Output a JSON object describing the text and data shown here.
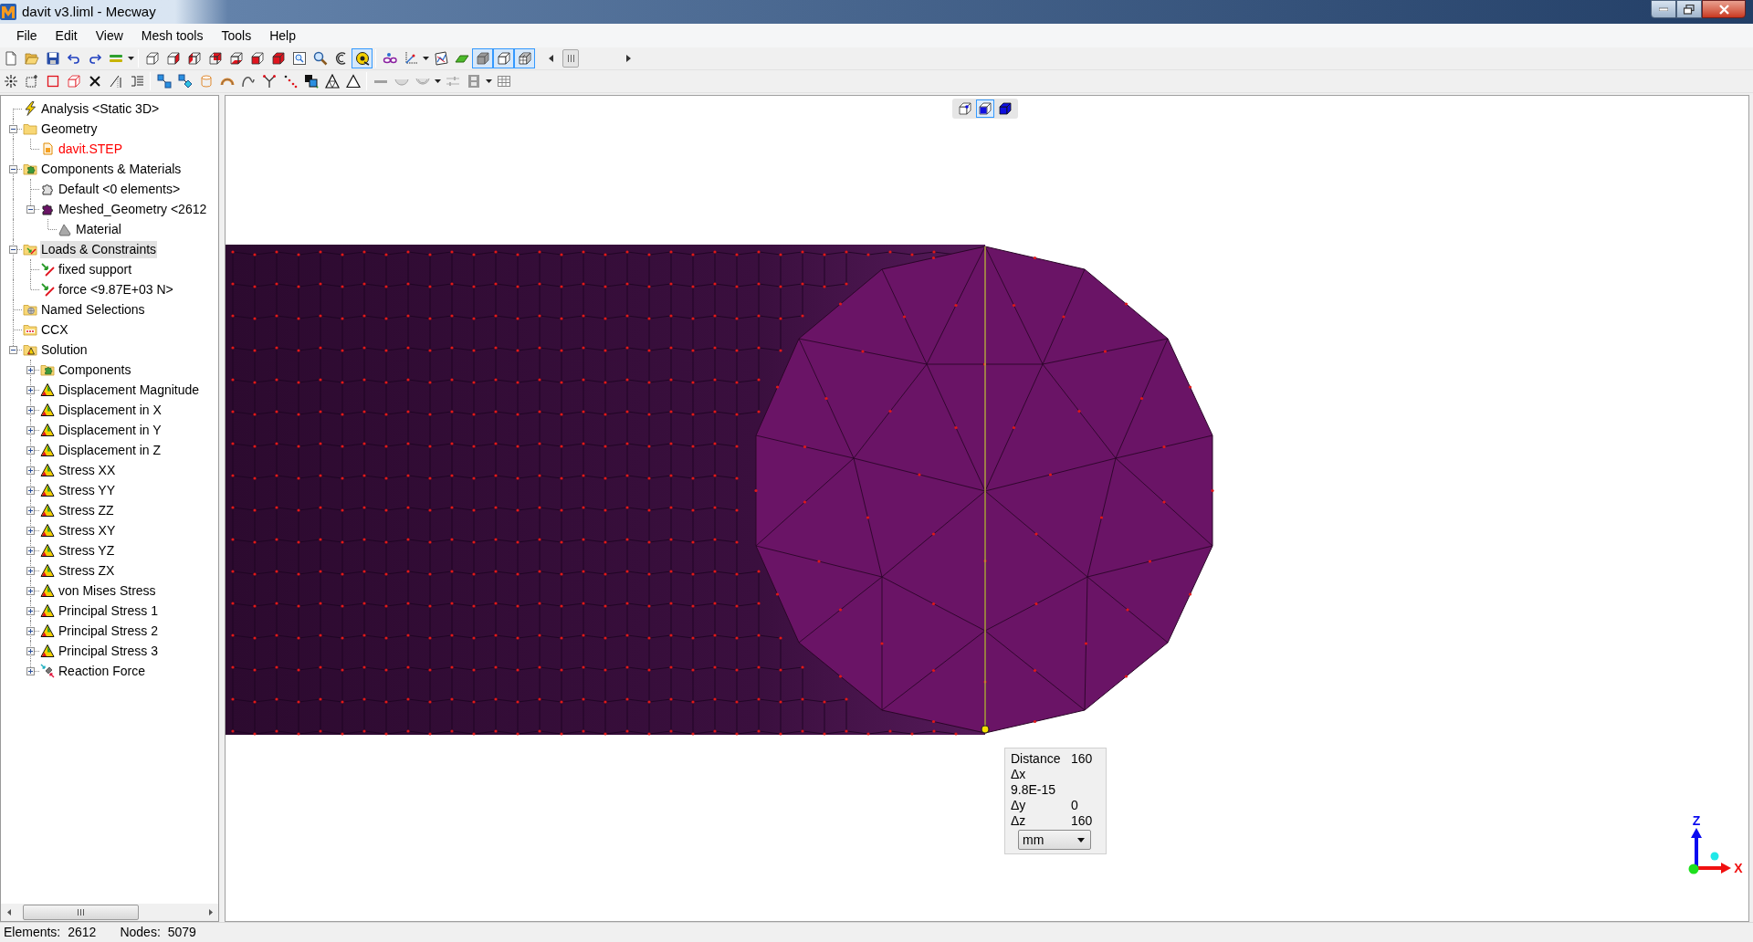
{
  "window": {
    "title": "davit v3.liml - Mecway"
  },
  "menu": [
    "File",
    "Edit",
    "View",
    "Mesh tools",
    "Tools",
    "Help"
  ],
  "toolbars": [
    [
      {
        "kind": "new-file"
      },
      {
        "kind": "open"
      },
      {
        "kind": "save"
      },
      {
        "kind": "undo"
      },
      {
        "kind": "redo"
      },
      {
        "kind": "layers"
      },
      {
        "kind": "dropdown"
      },
      {
        "kind": "separator"
      },
      {
        "kind": "view-iso"
      },
      {
        "kind": "view-right"
      },
      {
        "kind": "view-left"
      },
      {
        "kind": "view-back"
      },
      {
        "kind": "view-bottom"
      },
      {
        "kind": "view-front"
      },
      {
        "kind": "view-solid"
      },
      {
        "kind": "zoom-box"
      },
      {
        "kind": "zoom"
      },
      {
        "kind": "rotate"
      },
      {
        "kind": "measure",
        "pressed": true
      },
      {
        "kind": "separator"
      },
      {
        "kind": "glasses"
      },
      {
        "kind": "axes"
      },
      {
        "kind": "dropdown"
      },
      {
        "kind": "graph"
      },
      {
        "kind": "plane"
      },
      {
        "kind": "shaded",
        "pressed": true
      },
      {
        "kind": "wireframe",
        "pressed": true
      },
      {
        "kind": "mesh",
        "pressed": true
      },
      {
        "kind": "scroller"
      }
    ],
    [
      {
        "kind": "starburst"
      },
      {
        "kind": "box-starburst"
      },
      {
        "kind": "select-square"
      },
      {
        "kind": "select-cube"
      },
      {
        "kind": "delete"
      },
      {
        "kind": "split"
      },
      {
        "kind": "list"
      },
      {
        "kind": "separator"
      },
      {
        "kind": "link-squares"
      },
      {
        "kind": "link-shapes"
      },
      {
        "kind": "cylinder"
      },
      {
        "kind": "arc"
      },
      {
        "kind": "curve"
      },
      {
        "kind": "fork"
      },
      {
        "kind": "dots"
      },
      {
        "kind": "boxes"
      },
      {
        "kind": "tri-mesh"
      },
      {
        "kind": "triangle"
      },
      {
        "kind": "separator"
      },
      {
        "kind": "bar"
      },
      {
        "kind": "bowl"
      },
      {
        "kind": "bowl-2"
      },
      {
        "kind": "dropdown"
      },
      {
        "kind": "sliders"
      },
      {
        "kind": "film"
      },
      {
        "kind": "dropdown"
      },
      {
        "kind": "table"
      }
    ]
  ],
  "tree": [
    {
      "label": "Analysis <Static 3D>",
      "kind": "analysis",
      "selected": false
    },
    {
      "label": "Geometry",
      "kind": "folder",
      "selected": false,
      "expanded": true,
      "children": [
        {
          "label": "davit.STEP",
          "kind": "step-file",
          "selected": false,
          "color": "#ff0000"
        }
      ]
    },
    {
      "label": "Components & Materials",
      "kind": "component-folder",
      "selected": false,
      "expanded": true,
      "children": [
        {
          "label": "Default <0 elements>",
          "kind": "empty-component",
          "selected": false
        },
        {
          "label": "Meshed_Geometry <2612",
          "kind": "mesh-component",
          "selected": false,
          "expanded": true,
          "children": [
            {
              "label": "Material",
              "kind": "material",
              "selected": false
            }
          ]
        }
      ]
    },
    {
      "label": "Loads & Constraints",
      "kind": "load-folder",
      "selected": true,
      "expanded": true,
      "children": [
        {
          "label": "fixed support",
          "kind": "load",
          "selected": false
        },
        {
          "label": "force <9.87E+03 N>",
          "kind": "load",
          "selected": false
        }
      ]
    },
    {
      "label": "Named Selections",
      "kind": "selection-folder",
      "selected": false
    },
    {
      "label": "CCX",
      "kind": "solver-folder",
      "selected": false
    },
    {
      "label": "Solution",
      "kind": "solution-folder",
      "selected": false,
      "expanded": true,
      "children": [
        {
          "label": "Components",
          "kind": "component-folder",
          "selected": false,
          "expanded": false
        },
        {
          "label": "Displacement Magnitude",
          "kind": "result",
          "selected": false,
          "expanded": false
        },
        {
          "label": "Displacement in X",
          "kind": "result",
          "selected": false,
          "expanded": false
        },
        {
          "label": "Displacement in Y",
          "kind": "result",
          "selected": false,
          "expanded": false
        },
        {
          "label": "Displacement in Z",
          "kind": "result",
          "selected": false,
          "expanded": false
        },
        {
          "label": "Stress XX",
          "kind": "result",
          "selected": false,
          "expanded": false
        },
        {
          "label": "Stress YY",
          "kind": "result",
          "selected": false,
          "expanded": false
        },
        {
          "label": "Stress ZZ",
          "kind": "result",
          "selected": false,
          "expanded": false
        },
        {
          "label": "Stress XY",
          "kind": "result",
          "selected": false,
          "expanded": false
        },
        {
          "label": "Stress YZ",
          "kind": "result",
          "selected": false,
          "expanded": false
        },
        {
          "label": "Stress ZX",
          "kind": "result",
          "selected": false,
          "expanded": false
        },
        {
          "label": "von Mises Stress",
          "kind": "result",
          "selected": false,
          "expanded": false
        },
        {
          "label": "Principal Stress 1",
          "kind": "result",
          "selected": false,
          "expanded": false
        },
        {
          "label": "Principal Stress 2",
          "kind": "result",
          "selected": false,
          "expanded": false
        },
        {
          "label": "Principal Stress 3",
          "kind": "result",
          "selected": false,
          "expanded": false
        },
        {
          "label": "Reaction Force",
          "kind": "reaction",
          "selected": false,
          "expanded": false
        }
      ]
    }
  ],
  "viewport": {
    "view_buttons": [
      {
        "kind": "corner",
        "selected": false
      },
      {
        "kind": "face",
        "selected": true
      },
      {
        "kind": "solid",
        "selected": false
      }
    ],
    "measurement": {
      "rows": [
        {
          "label": "Distance",
          "value": "160"
        },
        {
          "label": "Δx",
          "value": "9.8E-15"
        },
        {
          "label": "Δy",
          "value": "0"
        },
        {
          "label": "Δz",
          "value": "160"
        }
      ],
      "unit": "mm"
    },
    "axes": {
      "z": "Z",
      "x": "X"
    }
  },
  "status_bar": [
    {
      "label": "Elements:",
      "value": "2612"
    },
    {
      "label": "Nodes:",
      "value": "5079"
    }
  ]
}
